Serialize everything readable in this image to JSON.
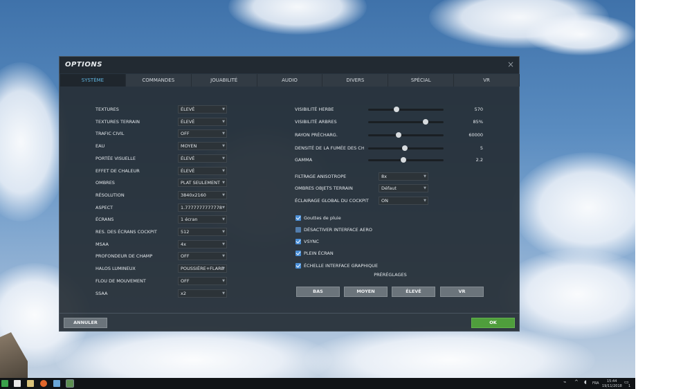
{
  "dialog": {
    "title": "OPTIONS",
    "close_glyph": "×"
  },
  "tabs": [
    {
      "label": "SYSTÈME",
      "active": true
    },
    {
      "label": "COMMANDES"
    },
    {
      "label": "JOUABILITÉ"
    },
    {
      "label": "AUDIO"
    },
    {
      "label": "DIVERS"
    },
    {
      "label": "SPÉCIAL"
    },
    {
      "label": "VR"
    }
  ],
  "left_settings": [
    {
      "label": "TEXTURES",
      "value": "ÉLEVÉ"
    },
    {
      "label": "TEXTURES TERRAIN",
      "value": "ÉLEVÉ"
    },
    {
      "label": "TRAFIC CIVIL",
      "value": "OFF"
    },
    {
      "label": "EAU",
      "value": "MOYEN"
    },
    {
      "label": "PORTÉE VISUELLE",
      "value": "ÉLEVÉ"
    },
    {
      "label": "EFFET DE CHALEUR",
      "value": "ÉLEVÉ"
    },
    {
      "label": "OMBRES",
      "value": "PLAT SEULEMENT"
    },
    {
      "label": "RÉSOLUTION",
      "value": "3840x2160"
    },
    {
      "label": "ASPECT",
      "value": "1.7777777777778"
    },
    {
      "label": "ÉCRANS",
      "value": "1 écran"
    },
    {
      "label": "RES. DES ÉCRANS COCKPIT",
      "value": "512"
    },
    {
      "label": "MSAA",
      "value": "4x"
    },
    {
      "label": "PROFONDEUR DE CHAMP",
      "value": "OFF"
    },
    {
      "label": "HALOS LUMINEUX",
      "value": "POUSSIÈRE+FLARE"
    },
    {
      "label": "FLOU DE MOUVEMENT",
      "value": "OFF"
    },
    {
      "label": "SSAA",
      "value": "x2"
    }
  ],
  "sliders": [
    {
      "label": "VISIBILITÉ HERBE",
      "value": "570",
      "level": 0.38
    },
    {
      "label": "VISIBILITÉ ARBRES",
      "value": "85%",
      "level": 0.76
    },
    {
      "label": "RAYON PRÉCHARG.",
      "value": "60000",
      "level": 0.4
    },
    {
      "label": "DENSITÉ DE LA FUMÉE DES CHE",
      "value": "5",
      "level": 0.49
    },
    {
      "label": "GAMMA",
      "value": "2.2",
      "level": 0.47
    }
  ],
  "right_selects": [
    {
      "label": "FILTRAGE ANISOTROPE",
      "value": "8x"
    },
    {
      "label": "OMBRES OBJETS TERRAIN",
      "value": "Défaut"
    },
    {
      "label": "ÉCLAIRAGE GLOBAL DU COCKPIT",
      "value": "ON"
    }
  ],
  "checkboxes": [
    {
      "label": "Gouttes de pluie",
      "checked": true
    },
    {
      "label": "DÉSACTIVER INTERFACE AERO",
      "checked": false
    },
    {
      "label": "VSYNC",
      "checked": true
    },
    {
      "label": "PLEIN ÉCRAN",
      "checked": true
    },
    {
      "label": "ÉCHELLE INTERFACE GRAPHIQUE",
      "checked": true
    }
  ],
  "presets": {
    "title": "PRÉRÉGLAGES",
    "buttons": [
      "BAS",
      "MOYEN",
      "ÉLEVÉ",
      "VR"
    ]
  },
  "footer": {
    "cancel_label": "ANNULER",
    "ok_label": "OK"
  },
  "taskbar": {
    "language": "FRA",
    "time": "15:44",
    "date": "19/11/2018",
    "notification_count": "1"
  },
  "colors": {
    "accent_tab": "#5fb4df",
    "ok_green": "#4f9e3c",
    "checkbox_blue": "#4a8fd8"
  }
}
